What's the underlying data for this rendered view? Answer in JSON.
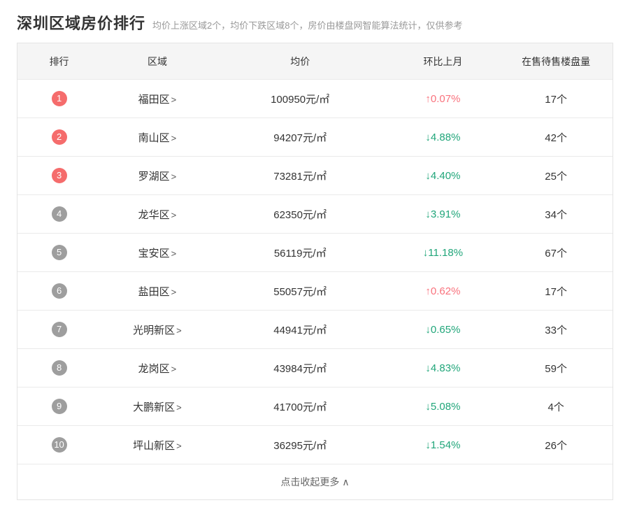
{
  "page": {
    "title": "深圳区域房价排行",
    "subtitle": "均价上涨区域2个，均价下跌区域8个，房价由楼盘网智能算法统计，仅供参考"
  },
  "table": {
    "headers": [
      "排行",
      "区域",
      "均价",
      "环比上月",
      "在售待售楼盘量"
    ],
    "region_arrow": ">",
    "rows": [
      {
        "rank": "1",
        "region": "福田区",
        "price": "100950元/㎡",
        "change": "↑0.07%",
        "trend": "up",
        "count": "17个"
      },
      {
        "rank": "2",
        "region": "南山区",
        "price": "94207元/㎡",
        "change": "↓4.88%",
        "trend": "down",
        "count": "42个"
      },
      {
        "rank": "3",
        "region": "罗湖区",
        "price": "73281元/㎡",
        "change": "↓4.40%",
        "trend": "down",
        "count": "25个"
      },
      {
        "rank": "4",
        "region": "龙华区",
        "price": "62350元/㎡",
        "change": "↓3.91%",
        "trend": "down",
        "count": "34个"
      },
      {
        "rank": "5",
        "region": "宝安区",
        "price": "56119元/㎡",
        "change": "↓11.18%",
        "trend": "down",
        "count": "67个"
      },
      {
        "rank": "6",
        "region": "盐田区",
        "price": "55057元/㎡",
        "change": "↑0.62%",
        "trend": "up",
        "count": "17个"
      },
      {
        "rank": "7",
        "region": "光明新区",
        "price": "44941元/㎡",
        "change": "↓0.65%",
        "trend": "down",
        "count": "33个"
      },
      {
        "rank": "8",
        "region": "龙岗区",
        "price": "43984元/㎡",
        "change": "↓4.83%",
        "trend": "down",
        "count": "59个"
      },
      {
        "rank": "9",
        "region": "大鹏新区",
        "price": "41700元/㎡",
        "change": "↓5.08%",
        "trend": "down",
        "count": "4个"
      },
      {
        "rank": "10",
        "region": "坪山新区",
        "price": "36295元/㎡",
        "change": "↓1.54%",
        "trend": "down",
        "count": "26个"
      }
    ],
    "footer": {
      "label": "点击收起更多",
      "icon": "∧"
    }
  },
  "colors": {
    "up": "#f9727d",
    "down": "#21a67a",
    "badge_top": "#f56c6c",
    "badge_normal": "#9e9e9e"
  }
}
